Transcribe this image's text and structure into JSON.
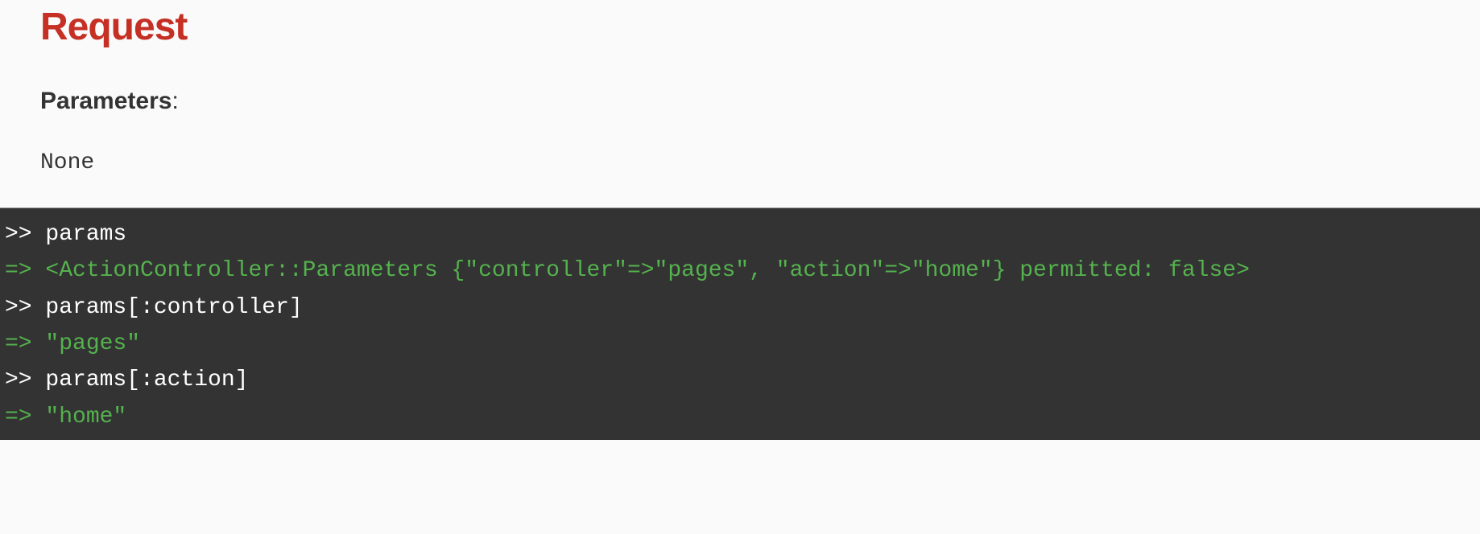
{
  "request": {
    "heading": "Request",
    "parameters_label": "Parameters",
    "parameters_colon": ":",
    "parameters_value": "None"
  },
  "console": {
    "prompt_in": ">> ",
    "prompt_out": "=> ",
    "lines": [
      {
        "type": "input",
        "text": "params"
      },
      {
        "type": "output",
        "text": "<ActionController::Parameters {\"controller\"=>\"pages\", \"action\"=>\"home\"} permitted: false>"
      },
      {
        "type": "input",
        "text": "params[:controller]"
      },
      {
        "type": "output",
        "text": "\"pages\""
      },
      {
        "type": "input",
        "text": "params[:action]"
      },
      {
        "type": "output",
        "text": "\"home\""
      }
    ]
  }
}
